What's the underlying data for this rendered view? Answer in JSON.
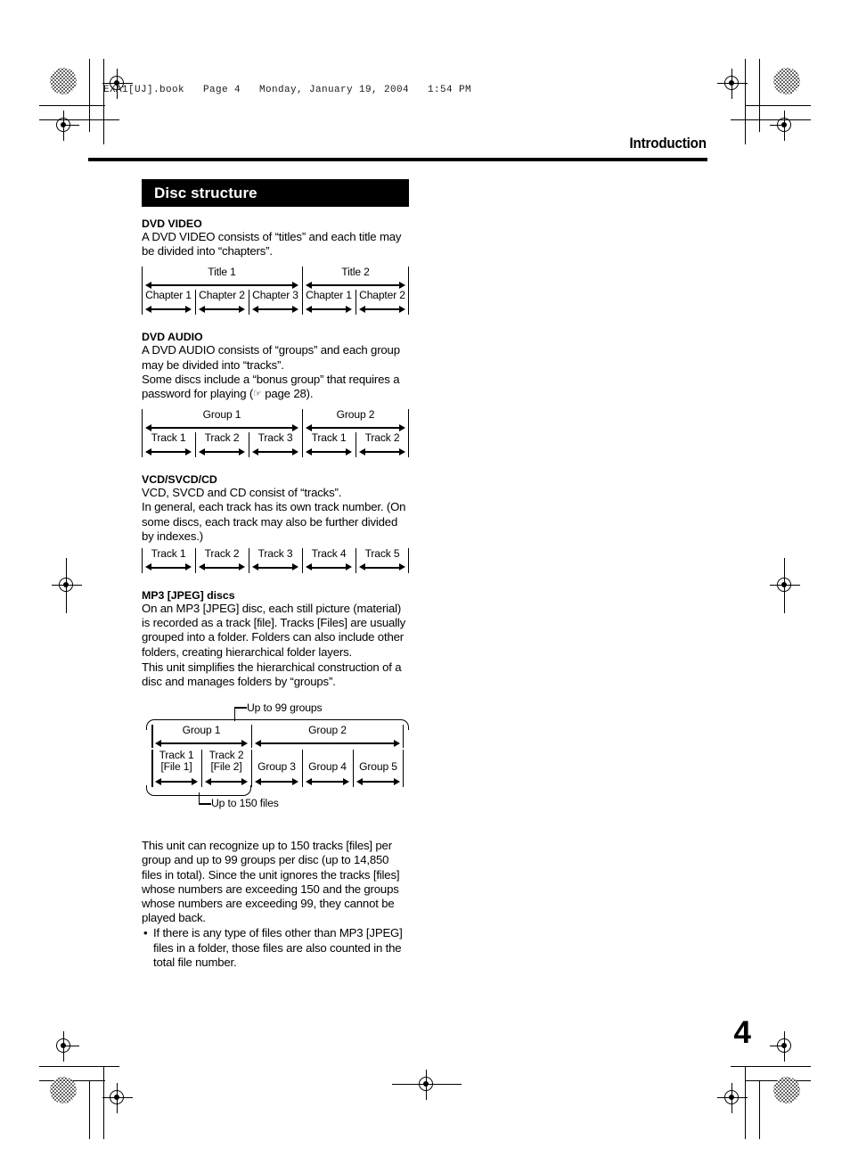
{
  "print_slug": "EXA1[UJ].book   Page 4   Monday, January 19, 2004   1:54 PM",
  "running_head": "Introduction",
  "section_title": "Disc structure",
  "page_number": "4",
  "sections": [
    {
      "heading": "DVD VIDEO",
      "paragraphs": [
        "A DVD VIDEO consists of “titles” and each title may be divided into “chapters”."
      ],
      "diagram": {
        "top_row": [
          "Title 1",
          "Title 2"
        ],
        "bottom_row": [
          "Chapter 1",
          "Chapter 2",
          "Chapter 3",
          "Chapter 1",
          "Chapter 2"
        ]
      }
    },
    {
      "heading": "DVD AUDIO",
      "paragraphs": [
        "A DVD AUDIO consists of “groups” and each group may be divided into “tracks”.",
        "Some discs include a “bonus group” that requires a password for playing (☞ page 28)."
      ],
      "diagram": {
        "top_row": [
          "Group 1",
          "Group 2"
        ],
        "bottom_row": [
          "Track 1",
          "Track 2",
          "Track 3",
          "Track 1",
          "Track 2"
        ]
      }
    },
    {
      "heading": "VCD/SVCD/CD",
      "paragraphs": [
        "VCD, SVCD and CD consist of “tracks”.",
        "In general, each track has its own track number. (On some discs, each track may also be further divided by indexes.)"
      ],
      "diagram": {
        "bottom_row": [
          "Track 1",
          "Track 2",
          "Track 3",
          "Track 4",
          "Track 5"
        ]
      }
    },
    {
      "heading": "MP3 [JPEG] discs",
      "paragraphs": [
        "On an MP3 [JPEG] disc, each still picture (material) is recorded as a track [file]. Tracks [Files] are usually grouped into a folder. Folders can also include other folders, creating hierarchical folder layers.",
        "This unit simplifies the hierarchical construction of a disc and manages folders by “groups”."
      ],
      "diagram": {
        "annotation_top": "Up to 99 groups",
        "annotation_bottom": "Up to 150 files",
        "top_row": [
          "Group 1",
          "Group 2"
        ],
        "bottom_row": [
          "Track 1\n[File 1]",
          "Track 2\n[File 2]",
          "Group 3",
          "Group 4",
          "Group 5"
        ]
      }
    }
  ],
  "closing": {
    "paragraph": "This unit can recognize up to 150 tracks [files] per group and up to 99 groups per disc (up to 14,850 files in total). Since the unit ignores the tracks [files] whose numbers are exceeding 150 and the groups whose numbers are exceeding 99, they cannot be played back.",
    "bullets": [
      "If there is any type of files other than MP3 [JPEG] files in a folder, those files are also counted in the total file number."
    ],
    "bullet_glyph": "•"
  },
  "icons": {
    "hand_pointer": "☞"
  }
}
